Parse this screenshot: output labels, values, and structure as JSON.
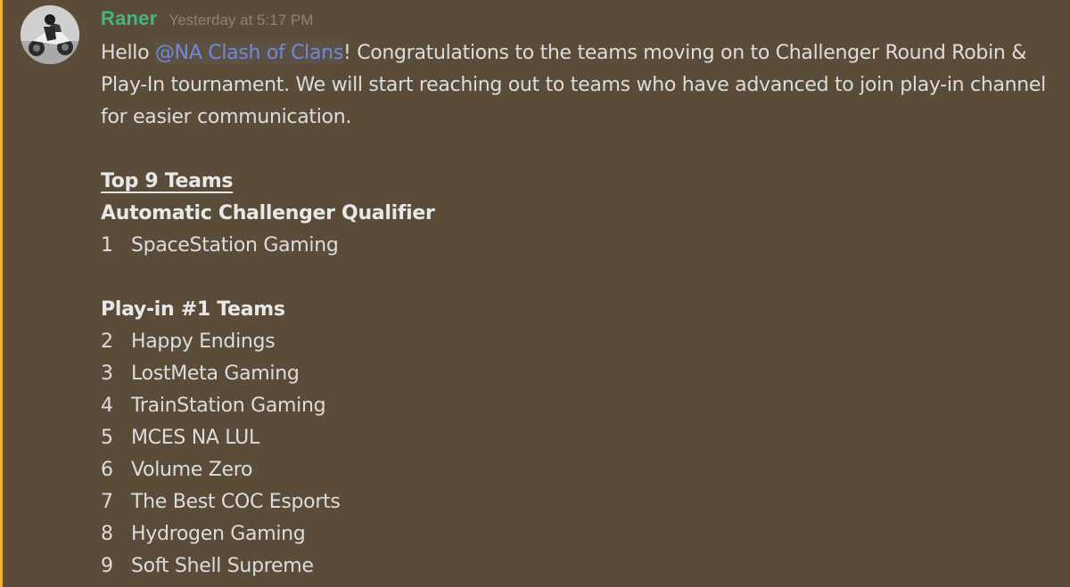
{
  "message": {
    "author": "Raner",
    "timestamp": "Yesterday at 5:17 PM",
    "intro_before": "Hello ",
    "mention": "@NA Clash of Clans",
    "intro_after": "! Congratulations to the teams moving on to Challenger Round Robin & Play-In tournament. We will start reaching out to teams who have advanced to join play-in channel for easier communication.",
    "heading_top": "Top 9 Teams",
    "heading_auto": "Automatic Challenger Qualifier",
    "auto_teams": [
      {
        "rank": "1",
        "name": "SpaceStation Gaming"
      }
    ],
    "heading_playin": "Play-in #1 Teams",
    "playin_teams": [
      {
        "rank": "2",
        "name": "Happy Endings"
      },
      {
        "rank": "3",
        "name": "LostMeta Gaming"
      },
      {
        "rank": "4",
        "name": "TrainStation Gaming"
      },
      {
        "rank": "5",
        "name": "MCES NA LUL"
      },
      {
        "rank": "6",
        "name": "Volume Zero"
      },
      {
        "rank": "7",
        "name": "The Best COC Esports"
      },
      {
        "rank": "8",
        "name": "Hydrogen Gaming"
      },
      {
        "rank": "9",
        "name": "Soft Shell Supreme"
      }
    ]
  },
  "colors": {
    "message_bg": "#5a4c38",
    "mention_bar": "#f0b232",
    "username": "#43b581",
    "mention": "#7289da"
  },
  "icons": {
    "avatar": "avatar-motorcycle-rider"
  }
}
